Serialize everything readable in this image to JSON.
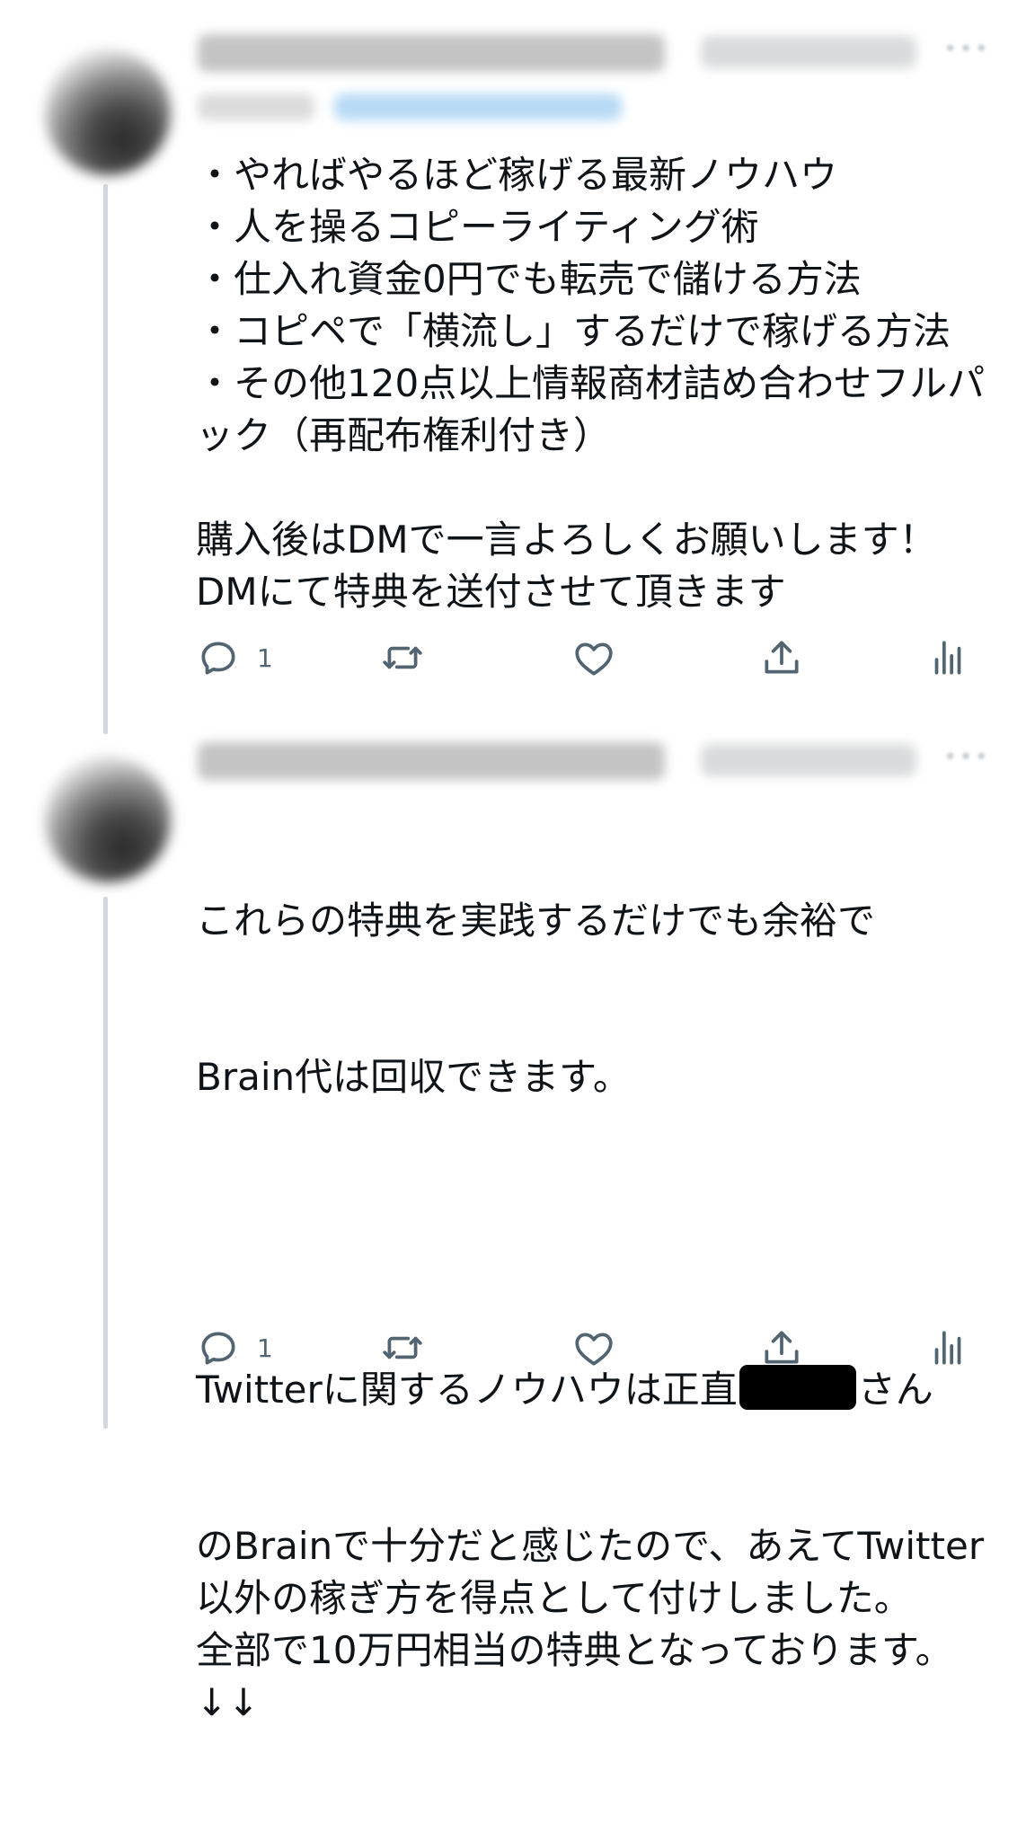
{
  "tweets": [
    {
      "body": "・やればやるほど稼げる最新ノウハウ\n・人を操るコピーライティング術\n・仕入れ資金0円でも転売で儲ける方法\n・コピペで「横流し」するだけで稼げる方法\n・その他120点以上情報商材詰め合わせフルパック（再配布権利付き）\n\n購入後はDMで一言よろしくお願いします！\nDMにて特典を送付させて頂きます",
      "reply_count": "1"
    },
    {
      "body_line1": "これらの特典を実践するだけでも余裕で",
      "body_line2": "Brain代は回収できます。",
      "body_line3_pre": "Twitterに関するノウハウは正直",
      "body_line3_post": "さん",
      "body_rest": "のBrainで十分だと感じたので、あえてTwitter以外の稼ぎ方を得点として付けしました。\n全部で10万円相当の特典となっております。\n↓↓",
      "reply_count": "1"
    }
  ],
  "icons": {
    "reply": "speech-bubble-icon",
    "retweet": "retweet-arrows-icon",
    "like": "heart-outline-icon",
    "share": "share-upload-icon",
    "analytics": "bar-chart-icon",
    "more": "ellipsis-icon"
  },
  "colors": {
    "text": "#0f1419",
    "icon_gray": "#536471",
    "thread_line": "#cfd9de",
    "mention_blue": "#1d9bf0"
  }
}
